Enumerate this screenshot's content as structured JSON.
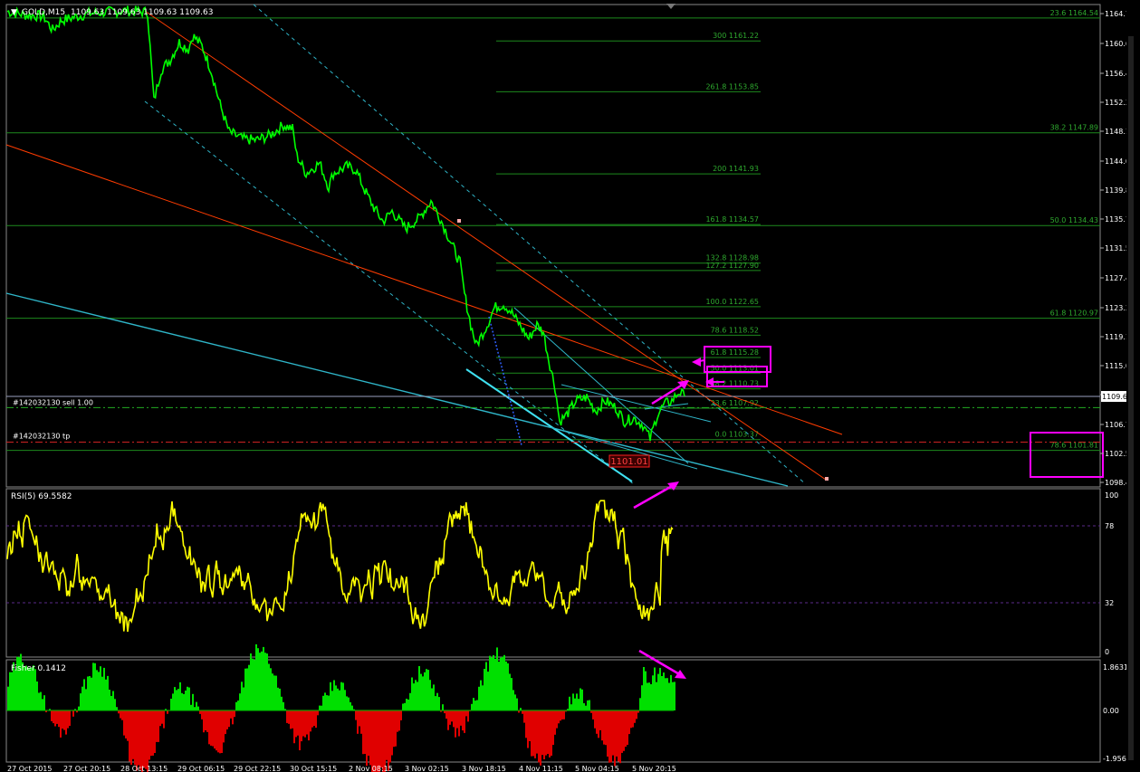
{
  "header": {
    "dropdown_icon": "triangle-down-icon",
    "symbol": "GOLD,M15",
    "ohlc": "1109.63 1109.63 1109.63 1109.63"
  },
  "colors": {
    "background": "#000000",
    "price": "#00ff00",
    "fibo": "#1d8a1d",
    "fibo_text": "#2ea82e",
    "trend_red": "#ff3c00",
    "trend_cyan": "#2fb5c8",
    "rsi": "#ffff00",
    "fisher_pos": "#00e000",
    "fisher_neg": "#e00000",
    "annotation": "#ff00ff",
    "axis_text": "#ffffff",
    "grid_dashed": "#5a2a8a"
  },
  "price_axis_ticks": [
    "1164.7",
    "1160.6",
    "1156.4",
    "1152.3",
    "1148.1",
    "1144.0",
    "1139.8",
    "1135.7",
    "1131.5",
    "1127.4",
    "1123.3",
    "1119.1",
    "1115.0",
    "1110.8",
    "1106.7",
    "1102.5",
    "1098.4"
  ],
  "price_axis_current": "1109.63",
  "fibo_levels": [
    {
      "label": "300 1161.22",
      "price": 1161.22
    },
    {
      "label": "261.8 1153.85",
      "price": 1153.85
    },
    {
      "label": "200 1141.93",
      "price": 1141.93
    },
    {
      "label": "161.8 1134.57",
      "price": 1134.57
    },
    {
      "label": "132.8 1128.98",
      "price": 1128.98
    },
    {
      "label": "127.2 1127.90",
      "price": 1127.9
    },
    {
      "label": "100.0 1122.65",
      "price": 1122.65
    },
    {
      "label": "78.6 1118.52",
      "price": 1118.52
    },
    {
      "label": "61.8 1115.28",
      "price": 1115.28
    },
    {
      "label": "50.0 1113.01",
      "price": 1113.01
    },
    {
      "label": "38.2 1110.73",
      "price": 1110.73
    },
    {
      "label": "23.6 1107.92",
      "price": 1107.92
    },
    {
      "label": "0.0 1103.37",
      "price": 1103.37
    }
  ],
  "fibo_long_levels": [
    {
      "label": "23.6 1164.54",
      "price": 1164.54
    },
    {
      "label": "38.2 1147.89",
      "price": 1147.89
    },
    {
      "label": "50.0 1134.43",
      "price": 1134.43
    },
    {
      "label": "61.8 1120.97",
      "price": 1120.97
    },
    {
      "label": "78.6 1101.81",
      "price": 1101.81
    }
  ],
  "order_labels": {
    "sell": "#142032130 sell 1.00",
    "tp": "#142032130 tp",
    "sell_price": 1108.0,
    "tp_price": 1103.0
  },
  "price_box_label": "1101.01",
  "rsi": {
    "label": "RSI(5) 69.5582",
    "ticks": [
      "100",
      "78",
      "32",
      "0"
    ],
    "levels": [
      78,
      32
    ]
  },
  "fisher": {
    "label": "Fisher 0.1412",
    "ticks": [
      "1.8631",
      "0.00",
      "-1.9566"
    ]
  },
  "time_axis_ticks": [
    "27 Oct 2015",
    "27 Oct 20:15",
    "28 Oct 13:15",
    "29 Oct 06:15",
    "29 Oct 22:15",
    "30 Oct 15:15",
    "2 Nov 08:15",
    "3 Nov 02:15",
    "3 Nov 18:15",
    "4 Nov 11:15",
    "5 Nov 04:15",
    "5 Nov 20:15"
  ],
  "chart_data": {
    "type": "line",
    "title": "GOLD,M15",
    "ylim": [
      1096.5,
      1166.5
    ],
    "series": [
      {
        "name": "GOLD,M15",
        "points": [
          [
            0,
            1165.5
          ],
          [
            20,
            1165.0
          ],
          [
            40,
            1164.8
          ],
          [
            50,
            1162.8
          ],
          [
            60,
            1164.2
          ],
          [
            90,
            1165.2
          ],
          [
            130,
            1165.6
          ],
          [
            155,
            1165.4
          ],
          [
            162,
            1152.5
          ],
          [
            170,
            1157.0
          ],
          [
            180,
            1158.5
          ],
          [
            190,
            1161.0
          ],
          [
            200,
            1160.0
          ],
          [
            205,
            1162.0
          ],
          [
            215,
            1160.5
          ],
          [
            225,
            1157.0
          ],
          [
            235,
            1152.0
          ],
          [
            245,
            1148.0
          ],
          [
            260,
            1147.0
          ],
          [
            275,
            1146.8
          ],
          [
            290,
            1147.5
          ],
          [
            305,
            1149.0
          ],
          [
            315,
            1148.5
          ],
          [
            320,
            1144.5
          ],
          [
            330,
            1142.0
          ],
          [
            345,
            1143.5
          ],
          [
            355,
            1140.0
          ],
          [
            360,
            1142.0
          ],
          [
            375,
            1143.0
          ],
          [
            385,
            1142.5
          ],
          [
            395,
            1139.5
          ],
          [
            405,
            1137.0
          ],
          [
            415,
            1135.0
          ],
          [
            425,
            1136.5
          ],
          [
            440,
            1134.0
          ],
          [
            455,
            1135.5
          ],
          [
            468,
            1138.0
          ],
          [
            478,
            1135.5
          ],
          [
            490,
            1132.0
          ],
          [
            500,
            1129.0
          ],
          [
            505,
            1124.5
          ],
          [
            512,
            1120.0
          ],
          [
            518,
            1117.0
          ],
          [
            522,
            1118.0
          ],
          [
            530,
            1120.0
          ],
          [
            538,
            1122.5
          ],
          [
            548,
            1123.0
          ],
          [
            556,
            1122.0
          ],
          [
            566,
            1120.0
          ],
          [
            576,
            1118.0
          ],
          [
            585,
            1120.0
          ],
          [
            592,
            1119.0
          ],
          [
            598,
            1115.0
          ],
          [
            605,
            1111.0
          ],
          [
            610,
            1106.0
          ],
          [
            618,
            1107.0
          ],
          [
            628,
            1109.0
          ],
          [
            640,
            1109.5
          ],
          [
            650,
            1107.5
          ],
          [
            660,
            1109.0
          ],
          [
            672,
            1108.0
          ],
          [
            682,
            1106.0
          ],
          [
            692,
            1106.5
          ],
          [
            702,
            1105.5
          ],
          [
            710,
            1103.5
          ],
          [
            718,
            1107.0
          ],
          [
            726,
            1108.5
          ],
          [
            734,
            1109.0
          ],
          [
            742,
            1110.3
          ],
          [
            748,
            1109.63
          ]
        ]
      }
    ]
  }
}
